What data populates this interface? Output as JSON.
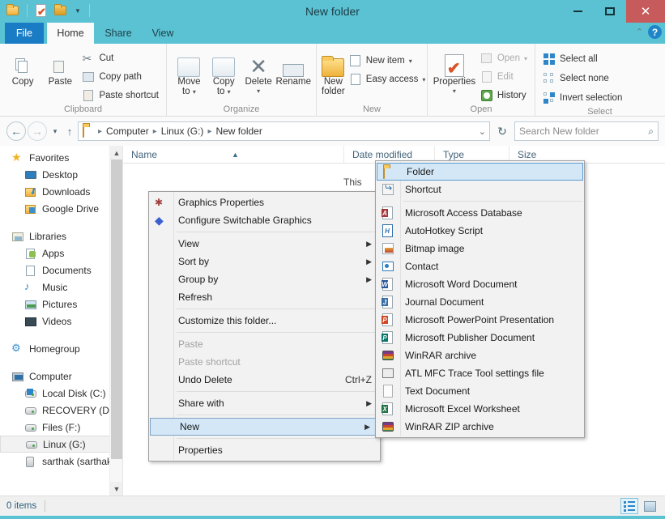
{
  "window": {
    "title": "New folder",
    "minimize_label": "Minimize",
    "maximize_label": "Maximize",
    "close_label": "✕"
  },
  "quick_access": {
    "items": [
      "folder-icon",
      "properties-icon",
      "new-folder-icon",
      "customize-caret"
    ]
  },
  "ribbon": {
    "tabs": [
      {
        "label": "File",
        "selected": false
      },
      {
        "label": "Home",
        "selected": true
      },
      {
        "label": "Share",
        "selected": false
      },
      {
        "label": "View",
        "selected": false
      }
    ],
    "groups": [
      {
        "name": "Clipboard",
        "label": "Clipboard",
        "big_buttons": [
          {
            "label": "Copy",
            "icon": "copy-icon"
          },
          {
            "label": "Paste",
            "icon": "paste-icon"
          }
        ],
        "small_buttons": [
          {
            "label": "Cut",
            "icon": "scissors-icon",
            "disabled": false
          },
          {
            "label": "Copy path",
            "icon": "copy-path-icon",
            "disabled": false
          },
          {
            "label": "Paste shortcut",
            "icon": "paste-shortcut-icon",
            "disabled": false
          }
        ]
      },
      {
        "name": "Organize",
        "label": "Organize",
        "big_buttons": [
          {
            "label": "Move\nto",
            "label_line1": "Move",
            "label_line2": "to",
            "icon": "move-to-icon",
            "caret": true
          },
          {
            "label": "Copy\nto",
            "label_line1": "Copy",
            "label_line2": "to",
            "icon": "copy-to-icon",
            "caret": true
          },
          {
            "label": "Delete",
            "icon": "delete-icon",
            "caret": true
          },
          {
            "label": "Rename",
            "icon": "rename-icon",
            "caret": false
          }
        ]
      },
      {
        "name": "New",
        "label": "New",
        "big_buttons": [
          {
            "label_line1": "New",
            "label_line2": "folder",
            "icon": "new-folder-icon"
          }
        ],
        "small_buttons": [
          {
            "label": "New item",
            "icon": "new-item-icon",
            "caret": true
          },
          {
            "label": "Easy access",
            "icon": "easy-access-icon",
            "caret": true
          }
        ]
      },
      {
        "name": "Open",
        "label": "Open",
        "big_buttons": [
          {
            "label": "Properties",
            "icon": "properties-icon",
            "caret": true
          }
        ],
        "small_buttons": [
          {
            "label": "Open",
            "icon": "open-icon",
            "caret": true,
            "disabled": true
          },
          {
            "label": "Edit",
            "icon": "edit-icon",
            "disabled": true
          },
          {
            "label": "History",
            "icon": "history-icon",
            "disabled": false
          }
        ]
      },
      {
        "name": "Select",
        "label": "Select",
        "small_buttons": [
          {
            "label": "Select all",
            "icon": "select-all-icon"
          },
          {
            "label": "Select none",
            "icon": "select-none-icon"
          },
          {
            "label": "Invert selection",
            "icon": "invert-selection-icon"
          }
        ]
      }
    ]
  },
  "address_bar": {
    "back_label": "◀",
    "forward_label": "▶",
    "recent_caret": "▾",
    "up_label": "↑",
    "breadcrumbs": [
      "Computer",
      "Linux (G:)",
      "New folder"
    ],
    "dropdown_caret": "⌄",
    "refresh_label": "↻",
    "search_placeholder": "Search New folder",
    "search_value": ""
  },
  "nav_pane": {
    "groups": [
      {
        "header": {
          "label": "Favorites",
          "icon": "star-icon"
        },
        "items": [
          {
            "label": "Desktop",
            "icon": "desktop-icon"
          },
          {
            "label": "Downloads",
            "icon": "downloads-icon"
          },
          {
            "label": "Google Drive",
            "icon": "google-drive-icon"
          }
        ]
      },
      {
        "header": {
          "label": "Libraries",
          "icon": "libraries-icon"
        },
        "items": [
          {
            "label": "Apps",
            "icon": "apps-icon"
          },
          {
            "label": "Documents",
            "icon": "documents-icon"
          },
          {
            "label": "Music",
            "icon": "music-icon"
          },
          {
            "label": "Pictures",
            "icon": "pictures-icon"
          },
          {
            "label": "Videos",
            "icon": "videos-icon"
          }
        ]
      },
      {
        "header": {
          "label": "Homegroup",
          "icon": "homegroup-icon"
        },
        "items": []
      },
      {
        "header": {
          "label": "Computer",
          "icon": "computer-icon"
        },
        "items": [
          {
            "label": "Local Disk (C:)",
            "icon": "local-disk-icon",
            "selected": false
          },
          {
            "label": "RECOVERY (D:)",
            "icon": "drive-icon",
            "selected": false
          },
          {
            "label": "Files (F:)",
            "icon": "drive-icon",
            "selected": false
          },
          {
            "label": "Linux (G:)",
            "icon": "drive-icon",
            "selected": true
          },
          {
            "label": "sarthak (sarthak-",
            "icon": "server-icon",
            "selected": false
          }
        ]
      }
    ]
  },
  "file_list": {
    "columns": [
      {
        "label": "Name",
        "sorted": true,
        "sort_dir": "asc"
      },
      {
        "label": "Date modified"
      },
      {
        "label": "Type"
      },
      {
        "label": "Size"
      }
    ],
    "rows": [],
    "empty_message": "This"
  },
  "status_bar": {
    "item_count": "0 items",
    "view_buttons": [
      {
        "name": "details-view",
        "active": true
      },
      {
        "name": "large-icons-view",
        "active": false
      }
    ]
  },
  "context_menu": {
    "sections": [
      {
        "items": [
          {
            "label": "Graphics Properties",
            "icon": "graphics-properties-icon"
          },
          {
            "label": "Configure Switchable Graphics",
            "icon": "switchable-graphics-icon"
          }
        ]
      },
      {
        "items": [
          {
            "label": "View",
            "submenu": true
          },
          {
            "label": "Sort by",
            "submenu": true
          },
          {
            "label": "Group by",
            "submenu": true
          },
          {
            "label": "Refresh"
          }
        ]
      },
      {
        "items": [
          {
            "label": "Customize this folder..."
          }
        ]
      },
      {
        "items": [
          {
            "label": "Paste",
            "disabled": true
          },
          {
            "label": "Paste shortcut",
            "disabled": true
          },
          {
            "label": "Undo Delete",
            "accel": "Ctrl+Z"
          }
        ]
      },
      {
        "items": [
          {
            "label": "Share with",
            "submenu": true
          }
        ]
      },
      {
        "items": [
          {
            "label": "New",
            "submenu": true,
            "highlighted": true
          }
        ]
      },
      {
        "items": [
          {
            "label": "Properties"
          }
        ]
      }
    ]
  },
  "new_submenu": {
    "sections": [
      {
        "items": [
          {
            "label": "Folder",
            "icon": "folder-icon",
            "highlighted": true
          },
          {
            "label": "Shortcut",
            "icon": "shortcut-icon"
          }
        ]
      },
      {
        "items": [
          {
            "label": "Microsoft Access Database",
            "icon": "access-icon",
            "tag": "A",
            "tag_color": "#A4373A"
          },
          {
            "label": "AutoHotkey Script",
            "icon": "autohotkey-icon",
            "tag": "H",
            "tag_color": "#2E6FA8"
          },
          {
            "label": "Bitmap image",
            "icon": "bitmap-icon"
          },
          {
            "label": "Contact",
            "icon": "contact-icon"
          },
          {
            "label": "Microsoft Word Document",
            "icon": "word-icon",
            "tag": "W",
            "tag_color": "#2B579A"
          },
          {
            "label": "Journal Document",
            "icon": "journal-icon",
            "tag": "J",
            "tag_color": "#3B6FA8"
          },
          {
            "label": "Microsoft PowerPoint Presentation",
            "icon": "powerpoint-icon",
            "tag": "P",
            "tag_color": "#D24726"
          },
          {
            "label": "Microsoft Publisher Document",
            "icon": "publisher-icon",
            "tag": "P",
            "tag_color": "#077568"
          },
          {
            "label": "WinRAR archive",
            "icon": "winrar-icon"
          },
          {
            "label": "ATL MFC Trace Tool settings file",
            "icon": "atl-mfc-icon"
          },
          {
            "label": "Text Document",
            "icon": "text-document-icon"
          },
          {
            "label": "Microsoft Excel Worksheet",
            "icon": "excel-icon",
            "tag": "X",
            "tag_color": "#217346"
          },
          {
            "label": "WinRAR ZIP archive",
            "icon": "winrar-zip-icon"
          }
        ]
      }
    ]
  },
  "colors": {
    "title_bar": "#5BC2D4",
    "file_tab": "#1A7CC4",
    "close_button": "#C75B5B",
    "menu_highlight": "#D3E7F7",
    "ribbon_bg": "#FAFAFA"
  }
}
